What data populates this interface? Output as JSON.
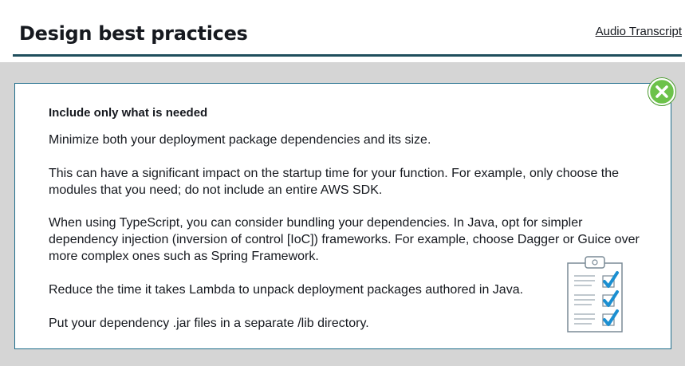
{
  "header": {
    "title": "Design best practices",
    "audio_link": "Audio Transcript"
  },
  "card": {
    "heading": "Include only what is needed",
    "paragraphs": [
      "Minimize both your deployment package dependencies and its size.",
      "This can have a significant impact on the startup time for your function. For example, only choose the modules that you need; do not include an entire AWS SDK.",
      "When using TypeScript, you can consider bundling your dependencies. In Java, opt for simpler dependency injection (inversion of control [IoC]) frameworks. For example, choose Dagger or Guice over more complex ones such as Spring Framework.",
      "Reduce the time it takes Lambda to unpack deployment packages authored in Java.",
      "Put your dependency .jar files in a separate /lib directory."
    ]
  },
  "icons": {
    "close": "close-icon",
    "clipboard": "checklist-clipboard-icon"
  },
  "colors": {
    "accent_rule": "#1f4e5c",
    "card_border": "#1f6e8c",
    "close_green": "#6cc24a",
    "check_blue": "#1b8fd1",
    "backdrop": "#d5d5d5"
  }
}
